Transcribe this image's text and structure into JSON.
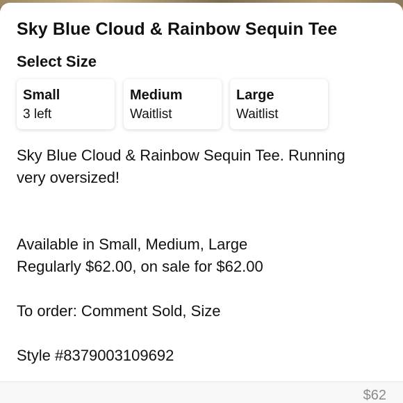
{
  "product": {
    "title": "Sky Blue Cloud & Rainbow Sequin Tee"
  },
  "size_selector": {
    "heading": "Select Size",
    "options": [
      {
        "label": "Small",
        "status": "3 left"
      },
      {
        "label": "Medium",
        "status": "Waitlist"
      },
      {
        "label": "Large",
        "status": "Waitlist"
      }
    ]
  },
  "description": {
    "intro_line1": "Sky Blue Cloud & Rainbow Sequin Tee. Running",
    "intro_line2": "very oversized!",
    "availability": "Available in Small, Medium, Large",
    "pricing": "Regularly $62.00, on sale for $62.00",
    "order_instructions": "To order: Comment Sold, Size",
    "style_number": "Style #8379003109692"
  },
  "footer": {
    "price": "$62"
  }
}
